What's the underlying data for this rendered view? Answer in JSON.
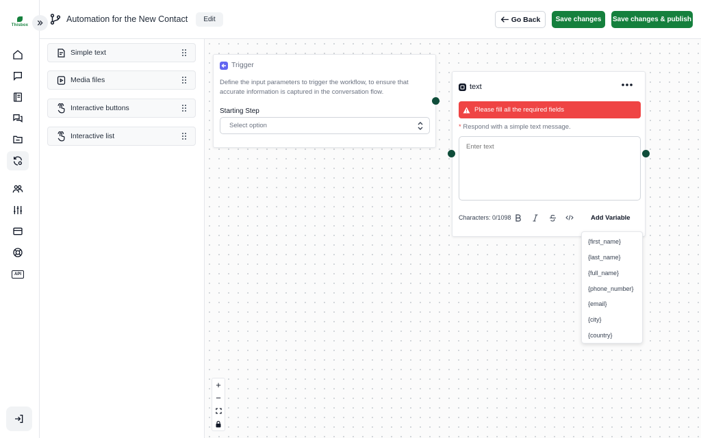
{
  "logo": {
    "text": "Thisbox"
  },
  "header": {
    "title": "Automation for the New Contact",
    "edit_label": "Edit",
    "go_back_label": "Go Back",
    "save_label": "Save changes",
    "save_publish_label": "Save changes & publish"
  },
  "rail": {
    "icons": [
      "home-icon",
      "chat-icon",
      "book-icon",
      "conversations-icon",
      "folder-icon",
      "automation-icon",
      "users-icon",
      "sliders-icon",
      "card-icon",
      "support-icon",
      "api-icon"
    ],
    "api_text": "API"
  },
  "palette": {
    "items": [
      {
        "label": "Simple text",
        "icon": "text-doc-icon"
      },
      {
        "label": "Media files",
        "icon": "media-icon"
      },
      {
        "label": "Interactive buttons",
        "icon": "tap-icon"
      },
      {
        "label": "Interactive list",
        "icon": "tap-icon"
      }
    ]
  },
  "trigger": {
    "title": "Trigger",
    "description": "Define the input parameters to trigger the workflow, to ensure that accurate information is captured in the conversation flow.",
    "step_label": "Starting Step",
    "select_placeholder": "Select option"
  },
  "text_node": {
    "title": "text",
    "alert": "Please fill all the required fields",
    "required_mark": "*",
    "respond_label": "Respond with a simple text message.",
    "placeholder": "Enter text",
    "characters": "Characters: 0/1098",
    "add_variable_label": "Add Variable"
  },
  "variables": [
    "{first_name}",
    "{last_name}",
    "{full_name}",
    "{phone_number}",
    "{email}",
    "{city}",
    "{country}"
  ],
  "zoom": {
    "plus": "+",
    "minus": "−"
  },
  "colors": {
    "primary": "#15803d",
    "alert": "#ef4444",
    "node_handle": "#0f4d3a",
    "trigger_badge": "#6366f1"
  }
}
